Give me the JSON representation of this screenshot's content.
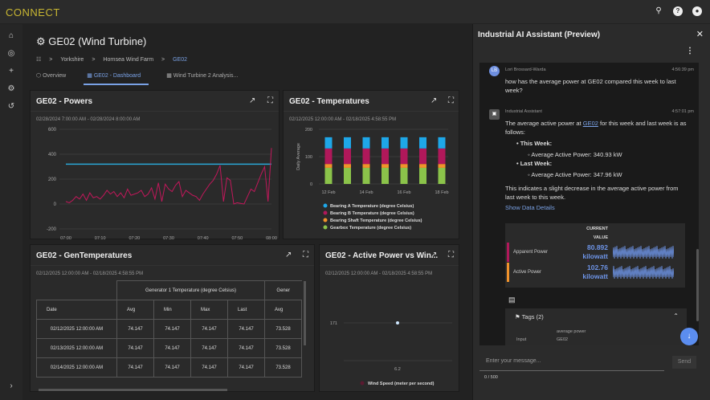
{
  "app": {
    "logo": "CONNECT",
    "top_icons": [
      "search-icon",
      "help-icon",
      "account-icon"
    ]
  },
  "sidebar": {
    "icons": [
      "home-icon",
      "compass-icon",
      "plus-icon",
      "settings-icon",
      "history-icon"
    ],
    "expand_icon": "chevron-right-icon"
  },
  "page": {
    "title": "GE02 (Wind Turbine)",
    "breadcrumb": [
      "Yorkshire",
      "Hornsea Wind Farm",
      "GE02"
    ],
    "tabs": [
      {
        "label": "Overview"
      },
      {
        "label": "GE02 - Dashboard",
        "active": true
      },
      {
        "label": "Wind Turbine 2 Analysis..."
      }
    ]
  },
  "colors": {
    "accent": "#7aa2e6",
    "logo": "#c8b632",
    "active_power": "#2aa7d6",
    "predicted": "#c2185b",
    "bearing_a": "#1ea7e8",
    "bearing_b": "#b0185a",
    "shaft": "#f0922b",
    "gearbox": "#8bc34a"
  },
  "panels": {
    "powers": {
      "title": "GE02 - Powers",
      "range": "02/28/2024 7:00:00 AM - 02/28/2024 8:00:00 AM"
    },
    "temps": {
      "title": "GE02 - Temperatures",
      "range": "02/12/2025 12:00:00 AM - 02/18/2025 4:58:55 PM"
    },
    "gen": {
      "title": "GE02 - GenTemperatures",
      "range": "02/12/2025 12:00:00 AM - 02/18/2025 4:58:55 PM",
      "group1": "Generator 1 Temperature (degree Celsius)",
      "group2": "Gener",
      "columns": [
        "Date",
        "Avg",
        "Min",
        "Max",
        "Last",
        "Avg"
      ],
      "rows": [
        [
          "02/12/2025 12:00:00 AM",
          "74.147",
          "74.147",
          "74.147",
          "74.147",
          "73.528"
        ],
        [
          "02/13/2025 12:00:00 AM",
          "74.147",
          "74.147",
          "74.147",
          "74.147",
          "73.528"
        ],
        [
          "02/14/2025 12:00:00 AM",
          "74.147",
          "74.147",
          "74.147",
          "74.147",
          "73.528"
        ]
      ]
    },
    "scatter": {
      "title": "GE02 - Active Power vs Win...",
      "range": "02/12/2025 12:00:00 AM - 02/18/2025 4:58:55 PM"
    }
  },
  "chart_data": [
    {
      "type": "line",
      "ylim": [
        -200,
        600
      ],
      "yticks": [
        600,
        400,
        200,
        0,
        -200
      ],
      "xticks": [
        "07:00",
        "07:10",
        "07:20",
        "07:30",
        "07:40",
        "07:50",
        "08:00"
      ],
      "grid": true,
      "legend": "bottom",
      "series": [
        {
          "name": "GE02.Active Power (kilowatt)",
          "values": [
            320,
            320
          ]
        },
        {
          "name": "GE02.Active Power.Predicted (kilowatt)",
          "values": [
            20,
            10,
            30,
            60,
            40,
            80,
            30,
            90,
            50,
            60,
            40,
            70,
            110,
            80,
            100,
            60,
            90,
            50,
            120,
            70,
            80,
            90,
            110,
            60,
            80,
            130,
            40,
            170,
            20,
            160,
            120,
            100,
            150,
            180,
            60,
            110,
            90,
            70,
            60,
            30,
            80,
            120,
            160,
            190,
            240,
            310,
            20,
            210,
            190,
            0,
            10,
            5,
            0,
            60,
            120,
            100,
            170,
            240,
            300,
            20,
            450
          ]
        }
      ]
    },
    {
      "type": "bar",
      "stacked": true,
      "ylabel": "Daily Average",
      "ylim": [
        0,
        200
      ],
      "yticks": [
        200,
        100,
        0
      ],
      "categories": [
        "12 Feb",
        "13 Feb",
        "14 Feb",
        "15 Feb",
        "16 Feb",
        "17 Feb",
        "18 Feb"
      ],
      "xticks": [
        "12 Feb",
        "14 Feb",
        "16 Feb",
        "18 Feb"
      ],
      "legend": "bottom",
      "series": [
        {
          "name": "Gearbox Temperature (degree Celsius)",
          "values": [
            59,
            59,
            59,
            59,
            59,
            59,
            59
          ]
        },
        {
          "name": "Bearing Shaft Temperature (degree Celsius)",
          "values": [
            14,
            14,
            14,
            14,
            14,
            14,
            14
          ]
        },
        {
          "name": "Bearing B Temperature (degree Celsius)",
          "values": [
            57,
            57,
            57,
            57,
            57,
            57,
            57
          ]
        },
        {
          "name": "Bearing A Temperature (degree Celsius)",
          "values": [
            41,
            41,
            41,
            41,
            41,
            41,
            41
          ]
        }
      ]
    },
    {
      "type": "scatter",
      "points": [
        {
          "x": 6.2,
          "y": 171
        }
      ],
      "xtick": "6.2",
      "ytick": "171",
      "legend": "bottom",
      "series_name": "Wind Speed (meter per second)"
    }
  ],
  "assistant": {
    "title": "Industrial AI Assistant (Preview)",
    "user": {
      "initials": "LB",
      "name": "Lori Brossard-Warda",
      "time": "4:56:39 pm",
      "text": "how has the average power at GE02 compared this week to last week?"
    },
    "bot": {
      "name": "Industrial Assistant",
      "time": "4:57:01 pm",
      "intro_a": "The average active power at ",
      "link": "GE02",
      "intro_b": " for this week and last week is as follows:",
      "this_week": "This Week:",
      "this_val": "Average Active Power: 340.93 kW",
      "last_week": "Last Week:",
      "last_val": "Average Active Power: 347.96 kW",
      "summary": "This indicates a slight decrease in the average active power from last week to this week.",
      "details_link": "Show Data Details"
    },
    "details": {
      "header1": "CURRENT",
      "header2": "VALUE",
      "rows": [
        {
          "name": "Apparent Power",
          "value": "80.892",
          "unit": "kilowatt",
          "color": "#b0185a"
        },
        {
          "name": "Active Power",
          "value": "102.76",
          "unit": "kilowatt",
          "color": "#f0922b"
        }
      ]
    },
    "tags": {
      "label": "Tags (2)",
      "value1": "average power",
      "key2": "Input",
      "value2": "GE02"
    },
    "input_placeholder": "Enter your message...",
    "send": "Send",
    "counter": "0 / 500"
  }
}
